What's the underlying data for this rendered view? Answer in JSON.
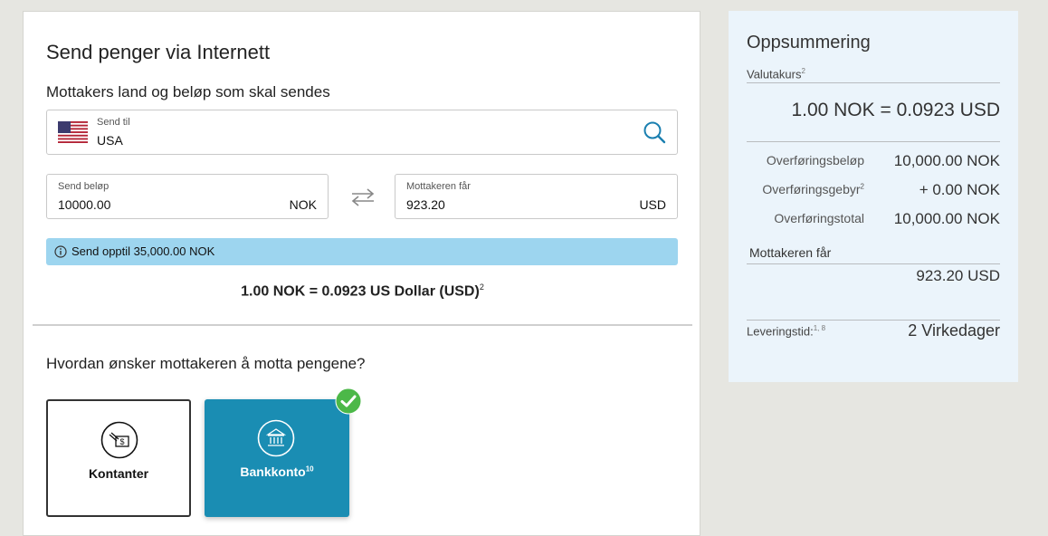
{
  "form": {
    "title": "Send penger via Internett",
    "recipient_section": "Mottakers land og beløp som skal sendes",
    "country": {
      "label": "Send til",
      "value": "USA"
    },
    "send_amount": {
      "label": "Send beløp",
      "value": "10000.00",
      "currency": "NOK"
    },
    "receive_amount": {
      "label": "Mottakeren får",
      "value": "923.20",
      "currency": "USD"
    },
    "info_banner": "Send opptil 35,000.00 NOK",
    "rate_text": "1.00 NOK = 0.0923 US Dollar (USD)",
    "rate_sup": "2",
    "method_section": "Hvordan ønsker mottakeren å motta pengene?",
    "methods": [
      {
        "label": "Kontanter",
        "sup": "",
        "selected": false
      },
      {
        "label": "Bankkonto",
        "sup": "10",
        "selected": true
      }
    ]
  },
  "summary": {
    "title": "Oppsummering",
    "rate_label": "Valutakurs",
    "rate_label_sup": "2",
    "rate_value": "1.00 NOK = 0.0923 USD",
    "rows": [
      {
        "label": "Overføringsbeløp",
        "sup": "",
        "value": "10,000.00 NOK"
      },
      {
        "label": "Overføringsgebyr",
        "sup": "2",
        "value": "+ 0.00 NOK"
      },
      {
        "label": "Overføringstotal",
        "sup": "",
        "value": "10,000.00 NOK"
      }
    ],
    "receive_label": "Mottakeren får",
    "receive_value": "923.20 USD",
    "delivery_label": "Leveringstid:",
    "delivery_sup": "1, 8",
    "delivery_value": "2 Virkedager"
  },
  "colors": {
    "banner": "#9dd5ef",
    "selected_card": "#1a8db3",
    "check": "#4cb848",
    "summary_bg": "#ebf4fb"
  }
}
